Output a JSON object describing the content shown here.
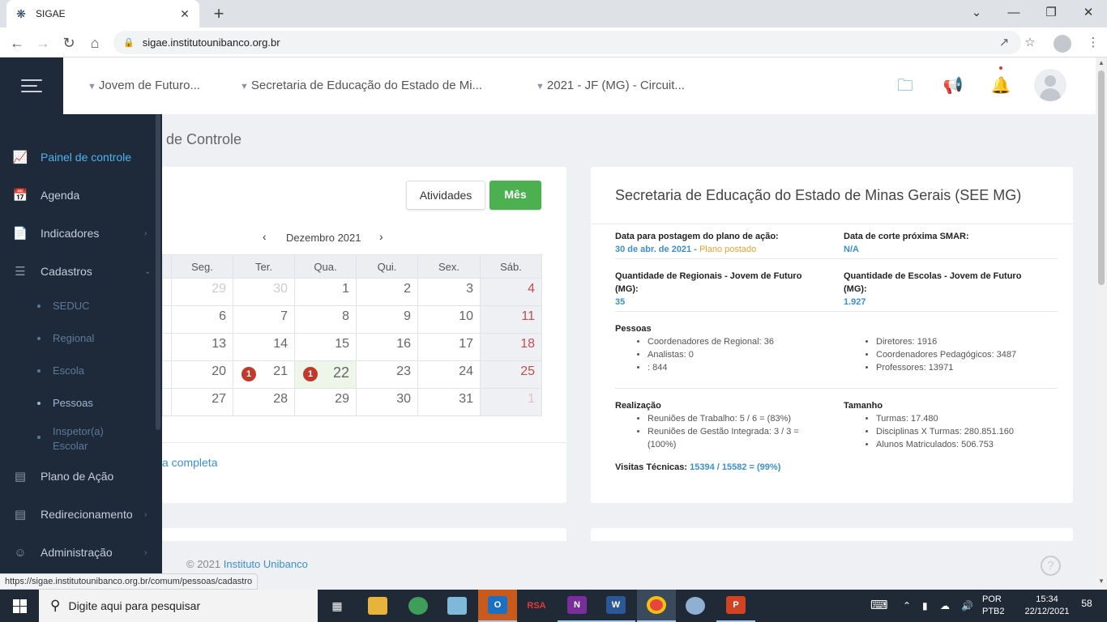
{
  "browser": {
    "tab_title": "SIGAE",
    "url": "sigae.institutounibanco.org.br",
    "status_url": "https://sigae.institutounibanco.org.br/comum/pessoas/cadastro"
  },
  "header": {
    "crumbs": [
      "Jovem de Futuro...",
      "Secretaria de Educação do Estado de Mi...",
      "2021 - JF (MG) - Circuit..."
    ]
  },
  "page": {
    "title": "de Controle",
    "agenda_link": "a completa",
    "footer_copy": "© 2021",
    "footer_brand": "Instituto Unibanco"
  },
  "calendar": {
    "btn_activities": "Atividades",
    "btn_month": "Mês",
    "month_label": "Dezembro 2021",
    "weekdays": [
      "",
      "Seg.",
      "Ter.",
      "Qua.",
      "Qui.",
      "Sex.",
      "Sáb."
    ],
    "weeks": [
      [
        "",
        "29",
        "30",
        "1",
        "2",
        "3",
        "4"
      ],
      [
        "",
        "6",
        "7",
        "8",
        "9",
        "10",
        "11"
      ],
      [
        "",
        "13",
        "14",
        "15",
        "16",
        "17",
        "18"
      ],
      [
        "",
        "20",
        "21",
        "22",
        "23",
        "24",
        "25"
      ],
      [
        "",
        "27",
        "28",
        "29",
        "30",
        "31",
        "1"
      ]
    ],
    "badge_21": "1",
    "badge_22": "1"
  },
  "secretaria": {
    "title": "Secretaria de Educação do Estado de Minas Gerais (SEE MG)",
    "plano_label": "Data para postagem do plano de ação:",
    "plano_value": "30 de abr. de 2021 -",
    "plano_note": "Plano postado",
    "smar_label": "Data de corte próxima SMAR:",
    "smar_value": "N/A",
    "regionais_label": "Quantidade de Regionais - Jovem de Futuro (MG):",
    "regionais_value": "35",
    "escolas_label": "Quantidade de Escolas - Jovem de Futuro (MG):",
    "escolas_value": "1.927",
    "pessoas_label": "Pessoas",
    "pessoas_left": [
      "Coordenadores de Regional: 36",
      "Analistas: 0",
      ": 844"
    ],
    "pessoas_right": [
      "Diretores: 1916",
      "Coordenadores Pedagógicos: 3487",
      "Professores: 13971"
    ],
    "realizacao_label": "Realização",
    "realizacao": [
      "Reuniões de Trabalho: 5 / 6 = (83%)",
      "Reuniões de Gestão Integrada: 3 / 3 = (100%)"
    ],
    "tamanho_label": "Tamanho",
    "tamanho": [
      "Turmas: 17.480",
      "Disciplinas X Turmas: 280.851.160",
      "Alunos Matriculados: 506.753"
    ],
    "visitas_label": "Visitas Técnicas:",
    "visitas_value": "15394 / 15582 = (99%)"
  },
  "sidebar": {
    "items": [
      {
        "label": "Painel de controle",
        "icon": "chart-line-icon"
      },
      {
        "label": "Agenda",
        "icon": "calendar-icon"
      },
      {
        "label": "Indicadores",
        "icon": "document-icon"
      },
      {
        "label": "Cadastros",
        "icon": "list-icon"
      },
      {
        "label": "Plano de Ação",
        "icon": "stack-icon"
      },
      {
        "label": "Redirecionamento",
        "icon": "redirect-icon"
      },
      {
        "label": "Administração",
        "icon": "user-icon"
      }
    ],
    "subitems": [
      "SEDUC",
      "Regional",
      "Escola",
      "Pessoas",
      "Inspetor(a) Escolar"
    ]
  },
  "taskbar": {
    "search_placeholder": "Digite aqui para pesquisar",
    "lang_top": "POR",
    "lang_bottom": "PTB2",
    "time": "15:34",
    "date": "22/12/2021",
    "notif_count": "58",
    "rsa_label": "RSA"
  },
  "colors": {
    "sidebar_bg": "#1e2a3a",
    "accent_blue": "#3a8fd6",
    "green": "#4caf50",
    "badge_red": "#c0392b",
    "header_icon_blue": "#3a9ad9",
    "header_icon_orange": "#f08a24"
  }
}
